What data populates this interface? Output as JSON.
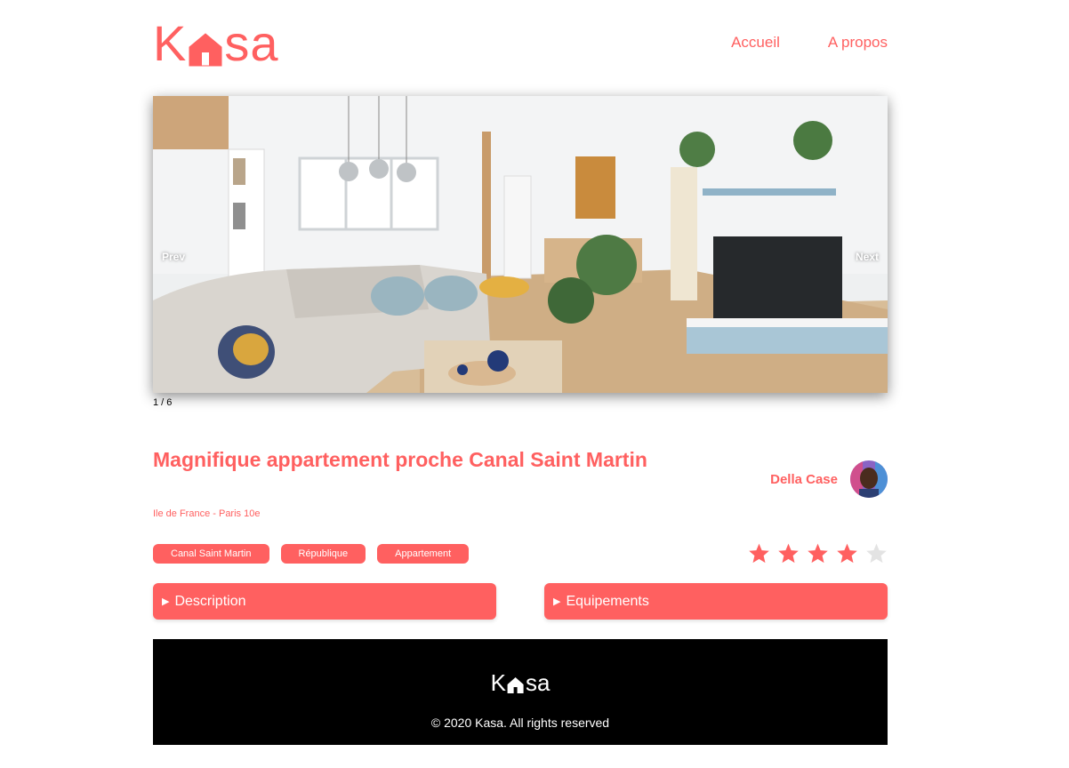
{
  "brand": {
    "logo_letters": [
      "K",
      "sa"
    ],
    "color": "#FF6060"
  },
  "nav": {
    "home": "Accueil",
    "about": "A propos"
  },
  "gallery": {
    "prev": "Prev",
    "next": "Next",
    "counter": "1 / 6"
  },
  "listing": {
    "title": "Magnifique appartement proche Canal Saint Martin",
    "location": "Ile de France - Paris 10e",
    "host_name": "Della Case",
    "tags": [
      "Canal Saint Martin",
      "République",
      "Appartement"
    ],
    "rating": 4,
    "rating_max": 5
  },
  "collapses": {
    "description": "Description",
    "equipments": "Equipements"
  },
  "footer": {
    "copyright": "© 2020 Kasa. All rights reserved"
  },
  "icons": {
    "logo": "house-icon",
    "star": "star-icon",
    "arrow": "triangle-right-icon"
  }
}
